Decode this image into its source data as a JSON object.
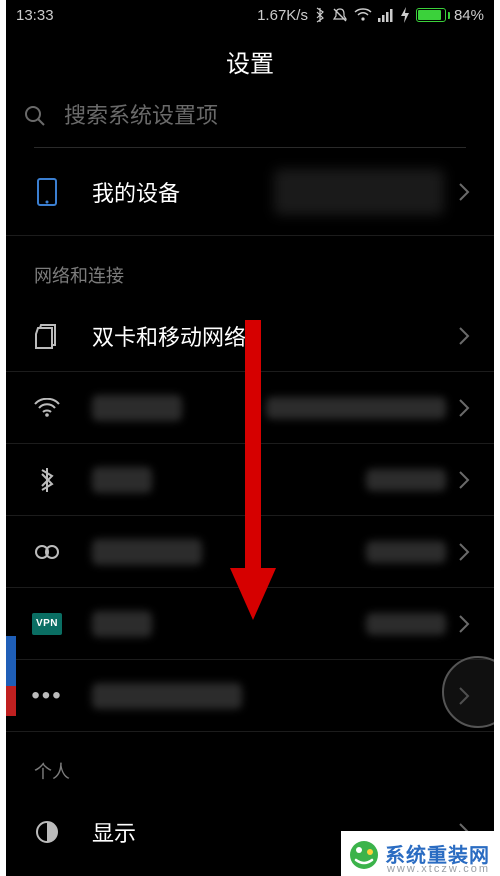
{
  "status": {
    "time": "13:33",
    "net_speed": "1.67K/s",
    "battery_pct": "84%"
  },
  "header": {
    "title": "设置"
  },
  "search": {
    "placeholder": "搜索系统设置项"
  },
  "device": {
    "label": "我的设备"
  },
  "sections": {
    "network_header": "网络和连接",
    "personal_header": "个人"
  },
  "rows": {
    "sim": {
      "label": "双卡和移动网络"
    },
    "display": {
      "label": "显示"
    }
  },
  "vpn_badge": "VPN",
  "watermark": {
    "text": "系统重装网",
    "sub": "www.xtczw.com"
  }
}
